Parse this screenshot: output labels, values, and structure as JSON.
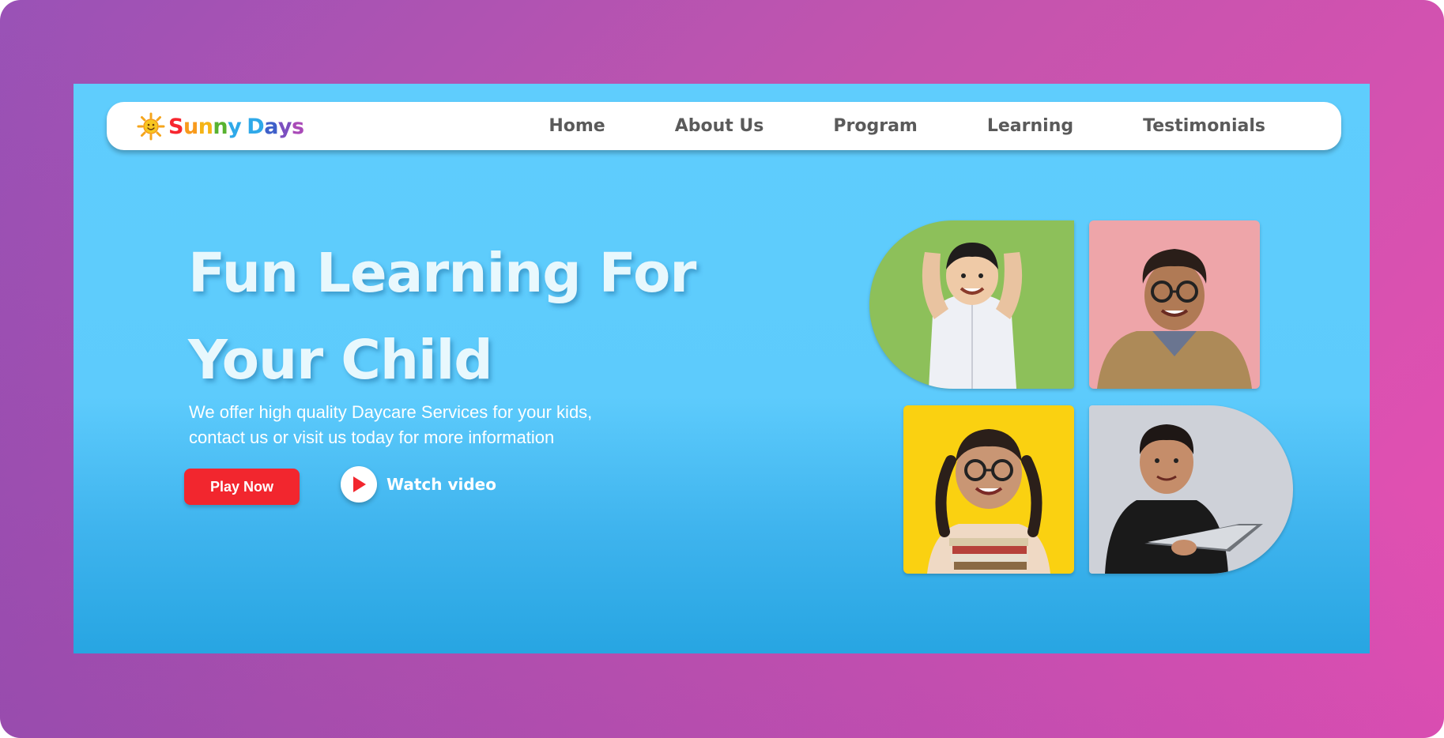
{
  "brand": {
    "name_parts": [
      "S",
      "u",
      "n",
      "n",
      "y",
      " ",
      "D",
      "a",
      "y",
      "s"
    ],
    "name_colors": [
      "#f7262f",
      "#f89a1c",
      "#f5c318",
      "#58b230",
      "#2fa9e9",
      "#ffffff",
      "#2fa9e9",
      "#3e5fc9",
      "#7b4fc0",
      "#a94ab8"
    ]
  },
  "nav": {
    "items": [
      "Home",
      "About Us",
      "Program",
      "Learning",
      "Testimonials"
    ]
  },
  "hero": {
    "title_line1": "Fun Learning For",
    "title_line2": "Your Child",
    "subtitle_line1": "We offer high quality Daycare Services for your kids,",
    "subtitle_line2": "contact us or visit us today for more information",
    "play_label": "Play Now",
    "watch_label": "Watch video"
  },
  "colors": {
    "site_bg": "#5fcdfd",
    "frame_bg": "#c454ae",
    "play_button": "#f2262e",
    "tile_green": "#8dc05a",
    "tile_pink": "#eea5a9",
    "tile_yellow": "#fad111",
    "tile_gray": "#ced1d8"
  }
}
